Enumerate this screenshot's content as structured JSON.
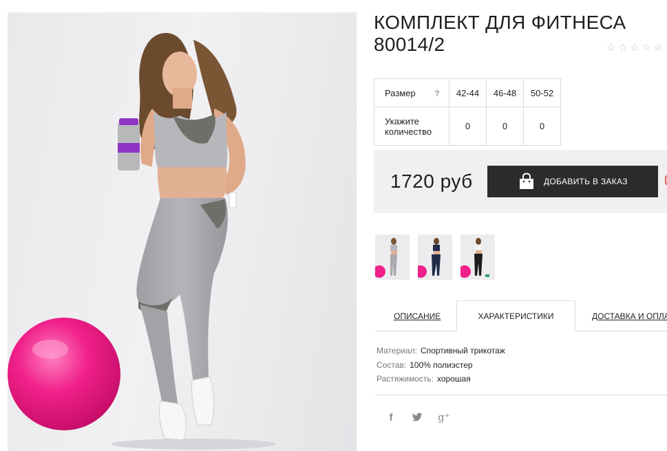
{
  "product": {
    "title_line1": "КОМПЛЕКТ ДЛЯ ФИТНЕСА",
    "title_line2": "80014/2",
    "rating_stars": 5,
    "rating_filled": 0,
    "star_glyph": "☆"
  },
  "size_table": {
    "size_label": "Размер",
    "help_mark": "?",
    "sizes": [
      "42-44",
      "46-48",
      "50-52"
    ],
    "qty_label_line1": "Укажите",
    "qty_label_line2": "количество",
    "quantities": [
      "0",
      "0",
      "0"
    ]
  },
  "purchase": {
    "price": "1720 руб",
    "add_button_label": "ДОБАВИТЬ В ЗАКАЗ"
  },
  "tabs": [
    {
      "label": "ОПИСАНИЕ",
      "active": false
    },
    {
      "label": "ХАРАКТЕРИСТИКИ",
      "active": true
    },
    {
      "label": "ДОСТАВКА И ОПЛА",
      "active": false
    }
  ],
  "specs": [
    {
      "key": "Материал:",
      "value": "Спортивный трикотаж"
    },
    {
      "key": "Состав:",
      "value": "100% полиэстер"
    },
    {
      "key": "Растяжимость:",
      "value": "хорошая"
    }
  ],
  "social": {
    "facebook": "f",
    "twitter": "🐦",
    "gplus": "g⁺"
  },
  "colors": {
    "button_bg": "#2b2b2b",
    "price_bg": "#f0f0f0",
    "ball": "#e8197d",
    "outfit_gray": "#a9a9ad"
  }
}
